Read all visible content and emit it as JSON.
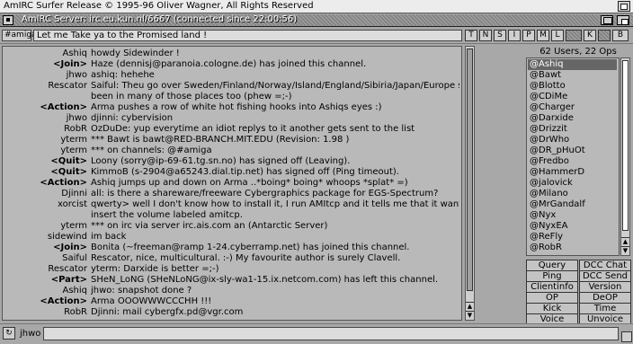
{
  "screen": {
    "title": "AmIRC Surfer Release © 1995-96 Oliver Wagner, All Rights Reserved"
  },
  "window": {
    "title": "AmIRC  Server: irc.eu.kun.nl/6667 (connected since 22:00:56)"
  },
  "channel": {
    "name": "#amiga",
    "topic": "Let me Take ya to the Promised land !",
    "modes": [
      "T",
      "N",
      "S",
      "I",
      "P",
      "M",
      "L",
      "",
      "K",
      "",
      "B"
    ]
  },
  "messages": [
    {
      "nick": "Ashiq",
      "event": false,
      "text": "howdy Sidewinder !"
    },
    {
      "nick": "<Join>",
      "event": true,
      "text": "Haze (dennisj@paranoia.cologne.de) has joined this channel."
    },
    {
      "nick": "jhwo",
      "event": false,
      "text": "ashiq: hehehe"
    },
    {
      "nick": "Rescator",
      "event": false,
      "text": "Saiful: Theu go over Sweden/Finland/Norway/Island/England/Sibiria/Japan/Europe she's"
    },
    {
      "nick": "",
      "event": false,
      "text": "been in many of those places too (phew =;-)"
    },
    {
      "nick": "<Action>",
      "event": true,
      "text": "Arma pushes a row of white hot fishing hooks into Ashiqs eyes :)"
    },
    {
      "nick": "jhwo",
      "event": false,
      "text": "djinni: cybervision"
    },
    {
      "nick": "RobR",
      "event": false,
      "text": "OzDuDe: yup everytime an idiot replys to it another gets sent to the list"
    },
    {
      "nick": "yterm",
      "event": false,
      "text": "*** Bawt is bawt@RED-BRANCH.MIT.EDU (Revision: 1.98 )"
    },
    {
      "nick": "yterm",
      "event": false,
      "text": "*** on channels: @#amiga"
    },
    {
      "nick": "<Quit>",
      "event": true,
      "text": "Loony (sorry@ip-69-61.tg.sn.no) has signed off (Leaving)."
    },
    {
      "nick": "<Quit>",
      "event": true,
      "text": "KimmoB (s-2904@a65243.dial.tip.net) has signed off (Ping timeout)."
    },
    {
      "nick": "<Action>",
      "event": true,
      "text": "Ashiq jumps up and down on Arma ..*boing* boing* whoops *splat* =)"
    },
    {
      "nick": "Djinni",
      "event": false,
      "text": "all: is there a shareware/freeware Cybergraphics package for EGS-Spectrum?"
    },
    {
      "nick": "xorcist",
      "event": false,
      "text": "qwerty> well I don't know how to install it, I run AMItcp and it tells me that it wants me to"
    },
    {
      "nick": "",
      "event": false,
      "text": "insert the volume labeled amitcp."
    },
    {
      "nick": "yterm",
      "event": false,
      "text": "*** on irc via server irc.ais.com an (Antarctic Server)"
    },
    {
      "nick": "sidewind",
      "event": false,
      "text": "im back"
    },
    {
      "nick": "<Join>",
      "event": true,
      "text": "Bonita (~freeman@ramp 1-24.cyberramp.net) has joined this channel."
    },
    {
      "nick": "Saiful",
      "event": false,
      "text": "Rescator, nice, multicultural. :-) My favourite author is surely Clavell."
    },
    {
      "nick": "Rescator",
      "event": false,
      "text": "yterm: Darxide is better =;-)"
    },
    {
      "nick": "<Part>",
      "event": true,
      "text": "SHeN_LoNG (SHeNLoNG@ix-sly-wa1-15.ix.netcom.com) has left this channel."
    },
    {
      "nick": "Ashiq",
      "event": false,
      "text": "jhwo: snapshot done ?"
    },
    {
      "nick": "<Action>",
      "event": true,
      "text": "Arma OOOWWWCCCHH !!!"
    },
    {
      "nick": "RobR",
      "event": false,
      "text": "Djinni: mail cybergfx.pd@vgr.com"
    }
  ],
  "users": {
    "summary": "62 Users, 22 Ops",
    "list": [
      "@Ashiq",
      "@Bawt",
      "@Blotto",
      "@CDiMe",
      "@Charger",
      "@Darxide",
      "@Drizzit",
      "@DrWho",
      "@DR_pHuOt",
      "@Fredbo",
      "@HammerD",
      "@jalovick",
      "@Milano",
      "@MrGandalf",
      "@Nyx",
      "@NyxEA",
      "@ReFly",
      "@RobR"
    ],
    "selected": 0
  },
  "buttons": [
    "Query",
    "DCC Chat",
    "Ping",
    "DCC Send",
    "Clientinfo",
    "Version",
    "OP",
    "DeOP",
    "Kick",
    "Time",
    "Voice",
    "Unvoice"
  ],
  "input": {
    "nick": "jhwo",
    "value": ""
  }
}
